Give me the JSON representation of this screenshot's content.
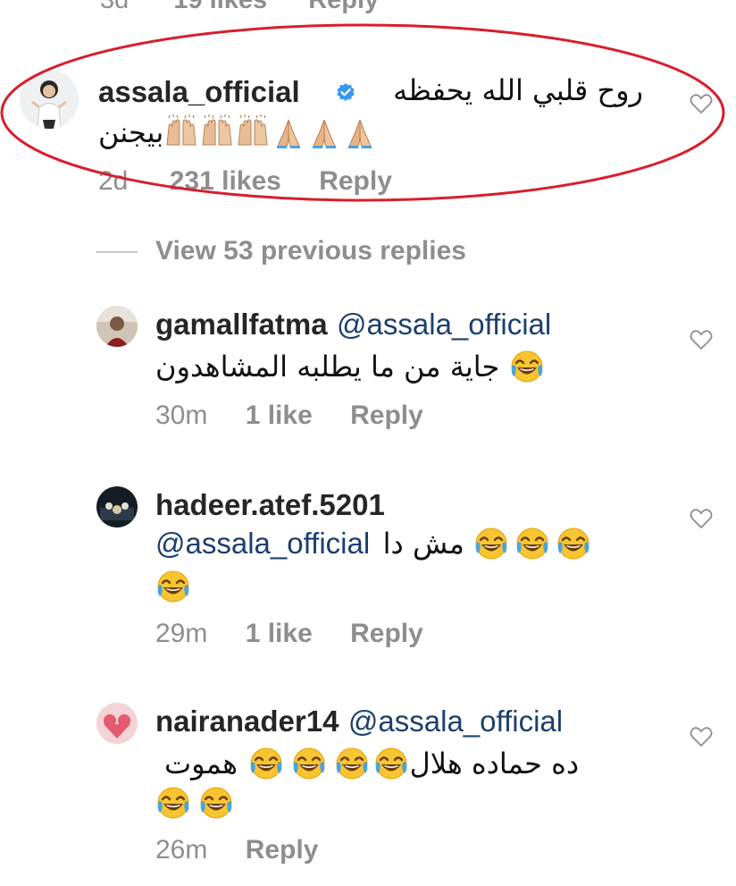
{
  "top_partial": {
    "time": "3d",
    "likes": "19 likes",
    "reply": "Reply"
  },
  "highlighted_comment": {
    "username": "assala_official",
    "text_line1": "روح قلبي الله يحفظه",
    "text_line2": "بيجنن",
    "time": "2d",
    "likes": "231 likes",
    "reply": "Reply",
    "annotation_color": "#d81e2c"
  },
  "view_previous": {
    "label": "View 53 previous replies"
  },
  "replies": [
    {
      "username": "gamallfatma",
      "mention": "@assala_official",
      "text_line1": "جاية من ما يطلبه المشاهدون",
      "time": "30m",
      "likes": "1 like",
      "reply": "Reply"
    },
    {
      "username": "hadeer.atef.5201",
      "mention": "@assala_official",
      "text_line1": "مش دا",
      "time": "29m",
      "likes": "1 like",
      "reply": "Reply"
    },
    {
      "username": "nairanader14",
      "mention": "@assala_official",
      "text_line1": "ده حماده هلال",
      "text_line1_b": "هموت",
      "time": "26m",
      "reply": "Reply"
    }
  ],
  "icons": {
    "heart": "heart-outline-icon",
    "verified": "verified-badge-icon",
    "laugh": "tears-of-joy-emoji",
    "pray": "folded-hands-emoji",
    "raise": "raising-hands-emoji"
  },
  "colors": {
    "mention": "#1c3f6e",
    "meta": "#8e8e8e",
    "text": "#262626",
    "verified": "#3897f0"
  }
}
